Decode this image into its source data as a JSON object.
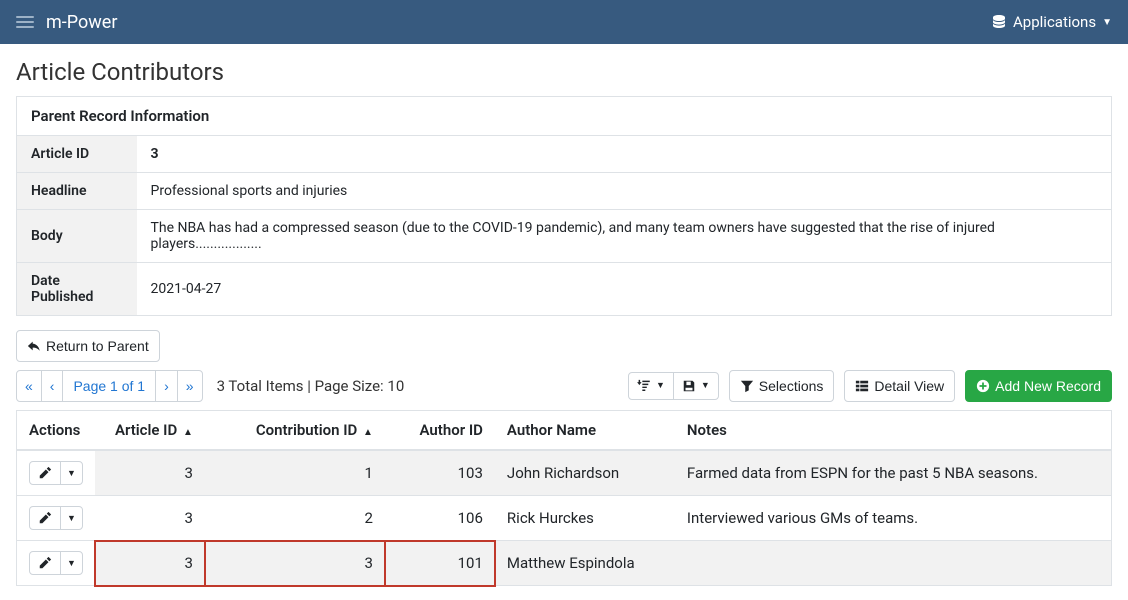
{
  "navbar": {
    "brand": "m-Power",
    "applications_label": "Applications"
  },
  "page": {
    "title": "Article Contributors",
    "parent_section_title": "Parent Record Information",
    "parent_fields": {
      "article_id": {
        "label": "Article ID",
        "value": "3"
      },
      "headline": {
        "label": "Headline",
        "value": "Professional sports and injuries"
      },
      "body": {
        "label": "Body",
        "value": "The NBA has had a compressed season (due to the COVID-19 pandemic), and many team owners have suggested that the rise of injured players.................."
      },
      "date_pub": {
        "label": "Date Published",
        "value": "2021-04-27"
      }
    }
  },
  "controls": {
    "return_to_parent": "Return to Parent",
    "pager_text": "Page 1 of 1",
    "status_text": "3 Total Items | Page Size: 10",
    "selections": "Selections",
    "detail_view": "Detail View",
    "add_new": "Add New Record"
  },
  "columns": {
    "actions": "Actions",
    "article_id": "Article ID",
    "contribution_id": "Contribution ID",
    "author_id": "Author ID",
    "author_name": "Author Name",
    "notes": "Notes"
  },
  "rows": [
    {
      "article_id": "3",
      "contribution_id": "1",
      "author_id": "103",
      "author_name": "John Richardson",
      "notes": "Farmed data from ESPN for the past 5 NBA seasons."
    },
    {
      "article_id": "3",
      "contribution_id": "2",
      "author_id": "106",
      "author_name": "Rick Hurckes",
      "notes": "Interviewed various GMs of teams."
    },
    {
      "article_id": "3",
      "contribution_id": "3",
      "author_id": "101",
      "author_name": "Matthew Espindola",
      "notes": ""
    }
  ],
  "highlight_row_index": 2
}
